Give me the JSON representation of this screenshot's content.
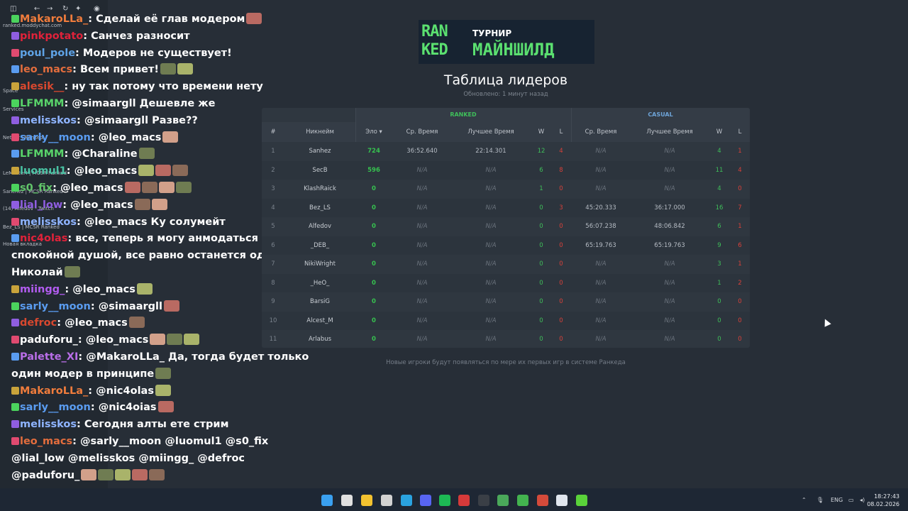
{
  "colors": {
    "bg": "#272e37",
    "accent_green": "#5be070",
    "casual_blue": "#6ea4d8",
    "win_green": "#3fbf5a",
    "loss_red": "#d9413a",
    "elo_green": "#36c24f",
    "na_gray": "#6b737d"
  },
  "sidebar": {
    "items": [
      "ranked.moddychat.com",
      "Space",
      "Services",
      "Nether | Ranked",
      "LeMaster! | MCSR Ranked",
      "Sanchez | MCSR Ranked",
      "(14) Alfedov - Twitch",
      "Bez_LS | MCSR Ranked",
      "Новая вкладка"
    ]
  },
  "chat": [
    {
      "nick": "MakaroLLa_",
      "color": "#f07c3c",
      "text": "Сделай её глав модером",
      "emotes": 1
    },
    {
      "nick": "pinkpotato",
      "color": "#e0223a",
      "text": "Санчез разносит",
      "emotes": 0
    },
    {
      "nick": "poul_pole",
      "color": "#5fa3e6",
      "text": "Модеров не существует!",
      "emotes": 0
    },
    {
      "nick": "leo_macs",
      "color": "#e36d3d",
      "text": "Всем привет!",
      "emotes": 2
    },
    {
      "nick": "alesik__",
      "color": "#d8482f",
      "text": "ну так потому что времени нету",
      "emotes": 0
    },
    {
      "nick": "LFMMM",
      "color": "#59d36a",
      "text": "@simaargll Дешевле же",
      "emotes": 0
    },
    {
      "nick": "melisskos",
      "color": "#8fb4ff",
      "text": "@simaargll Разве??",
      "emotes": 0
    },
    {
      "nick": "sarly__moon",
      "color": "#5a9cf0",
      "text": "@leo_macs",
      "emotes": 1
    },
    {
      "nick": "LFMMM",
      "color": "#59d36a",
      "text": "@Charaline",
      "emotes": 1
    },
    {
      "nick": "luomul1",
      "color": "#49c2a3",
      "text": "@leo_macs",
      "emotes": 3
    },
    {
      "nick": "s0_fix",
      "color": "#61c46a",
      "text": "@leo_macs",
      "emotes": 4
    },
    {
      "nick": "lial_low",
      "color": "#8f5ee0",
      "text": "@leo_macs",
      "emotes": 2
    },
    {
      "nick": "melisskos",
      "color": "#8fb4ff",
      "text": "@leo_macs Ку солумейт",
      "emotes": 0
    },
    {
      "nick": "nic4olas",
      "color": "#e0223a",
      "text": "все, теперь я могу анмодаться со спокойной душой, все равно останется один Николай",
      "emotes": 1
    },
    {
      "nick": "miingg_",
      "color": "#b25cf0",
      "text": "@leo_macs",
      "emotes": 1
    },
    {
      "nick": "sarly__moon",
      "color": "#5a9cf0",
      "text": "@simaargll",
      "emotes": 1
    },
    {
      "nick": "defroc",
      "color": "#d8482f",
      "text": "@leo_macs",
      "emotes": 1
    },
    {
      "nick": "paduforu_",
      "color": "#ffffff",
      "text": "@leo_macs",
      "emotes": 3
    },
    {
      "nick": "Palette_XI",
      "color": "#b96ee8",
      "text": "@MakaroLLa_ Да, тогда будет только один модер в принципе",
      "emotes": 1
    },
    {
      "nick": "MakaroLLa_",
      "color": "#f07c3c",
      "text": "@nic4olas",
      "emotes": 1
    },
    {
      "nick": "sarly__moon",
      "color": "#5a9cf0",
      "text": "@nic4oias",
      "emotes": 1
    },
    {
      "nick": "melisskos",
      "color": "#8fb4ff",
      "text": "Сегодня алты ете стрим",
      "emotes": 0
    },
    {
      "nick": "leo_macs",
      "color": "#e36d3d",
      "text": "@sarly__moon @luomul1 @s0_fix @lial_low @melisskos @miingg_ @defroc @paduforu_",
      "emotes": 5
    }
  ],
  "leaderboard": {
    "logo_left": "RAN KED",
    "logo_sub": "ТУРНИР",
    "logo_title": "МАЙНШИЛД",
    "title": "Таблица лидеров",
    "updated": "Обновлено: 1 минут назад",
    "group_ranked": "RANKED",
    "group_casual": "CASUAL",
    "headers": [
      "#",
      "Никнейм",
      "Эло ▾",
      "Ср. Время",
      "Лучшее Время",
      "W",
      "L",
      "Ср. Время",
      "Лучшее Время",
      "W",
      "L"
    ],
    "rows": [
      [
        "1",
        "Sanhez",
        "724",
        "36:52.640",
        "22:14.301",
        "12",
        "4",
        "N/A",
        "N/A",
        "4",
        "1"
      ],
      [
        "2",
        "SecB",
        "596",
        "N/A",
        "N/A",
        "6",
        "8",
        "N/A",
        "N/A",
        "11",
        "4"
      ],
      [
        "3",
        "KlashRaick",
        "0",
        "N/A",
        "N/A",
        "1",
        "0",
        "N/A",
        "N/A",
        "4",
        "0"
      ],
      [
        "4",
        "Bez_LS",
        "0",
        "N/A",
        "N/A",
        "0",
        "3",
        "45:20.333",
        "36:17.000",
        "16",
        "7"
      ],
      [
        "5",
        "Alfedov",
        "0",
        "N/A",
        "N/A",
        "0",
        "0",
        "56:07.238",
        "48:06.842",
        "6",
        "1"
      ],
      [
        "6",
        "_DEB_",
        "0",
        "N/A",
        "N/A",
        "0",
        "0",
        "65:19.763",
        "65:19.763",
        "9",
        "6"
      ],
      [
        "7",
        "NikiWright",
        "0",
        "N/A",
        "N/A",
        "0",
        "0",
        "N/A",
        "N/A",
        "3",
        "1"
      ],
      [
        "8",
        "_HeO_",
        "0",
        "N/A",
        "N/A",
        "0",
        "0",
        "N/A",
        "N/A",
        "1",
        "2"
      ],
      [
        "9",
        "BarsiG",
        "0",
        "N/A",
        "N/A",
        "0",
        "0",
        "N/A",
        "N/A",
        "0",
        "0"
      ],
      [
        "10",
        "Alcest_M",
        "0",
        "N/A",
        "N/A",
        "0",
        "0",
        "N/A",
        "N/A",
        "0",
        "0"
      ],
      [
        "11",
        "Arlabus",
        "0",
        "N/A",
        "N/A",
        "0",
        "0",
        "N/A",
        "N/A",
        "0",
        "0"
      ]
    ],
    "footer": "Новые игроки будут появляться по мере их первых игр в системе Ранкеда"
  },
  "taskbar": {
    "icons": [
      "windows-start-icon",
      "settings-icon",
      "file-explorer-icon",
      "app-icon",
      "telegram-icon",
      "discord-icon",
      "spotify-icon",
      "app-red-icon",
      "terminal-icon",
      "minecraft-icon",
      "app-green-icon",
      "app-record-icon",
      "app-c-icon",
      "minecraft-grass-icon"
    ],
    "lang": "ENG",
    "time": "18:27:43",
    "date": "08.02.2026"
  }
}
